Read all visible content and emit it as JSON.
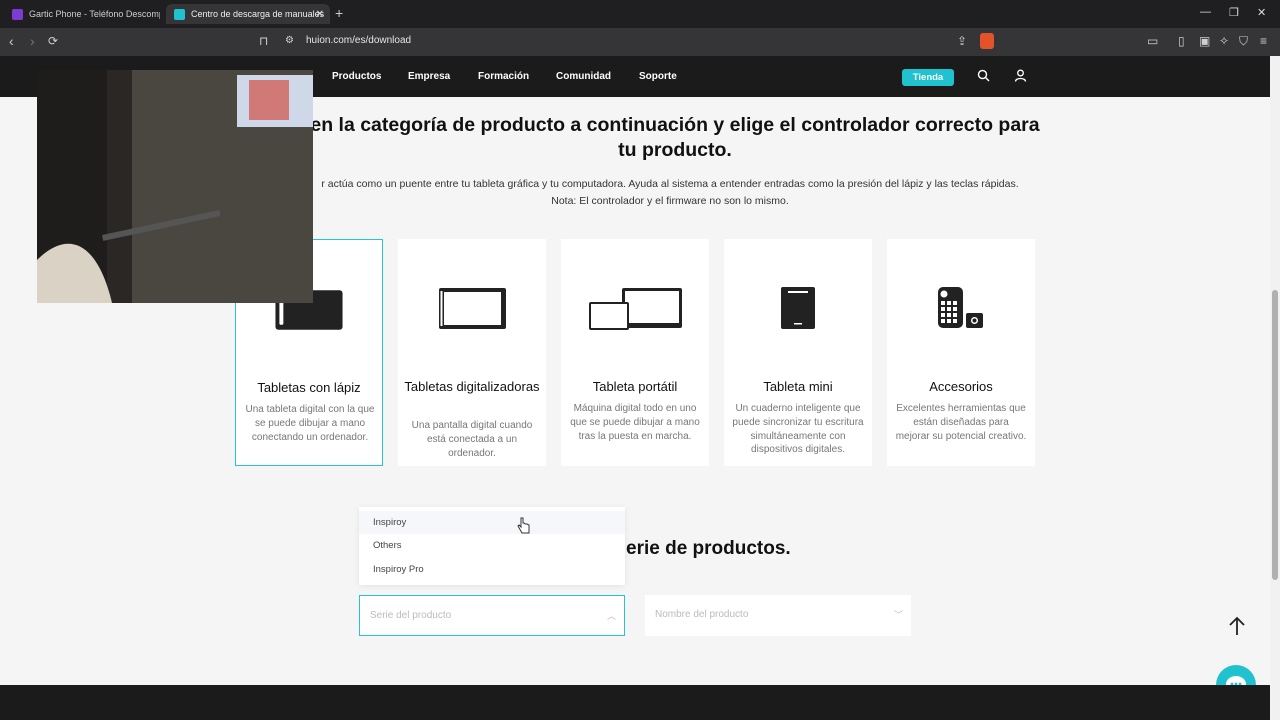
{
  "browser": {
    "tabs": [
      {
        "title": "Gartic Phone - Teléfono Descompuesto",
        "active": false
      },
      {
        "title": "Centro de descarga de manuales",
        "active": true
      }
    ],
    "url": "huion.com/es/download"
  },
  "header": {
    "nav": [
      "Productos",
      "Empresa",
      "Formación",
      "Comunidad",
      "Soporte"
    ],
    "shop_label": "Tienda"
  },
  "main": {
    "heading": "en la categoría de producto a continuación y elige el controlador correcto para tu producto.",
    "description_line1": "r actúa como un puente entre tu tableta gráfica y tu computadora. Ayuda al sistema a entender entradas como la presión del lápiz y las teclas rápidas.",
    "description_line2": "Nota: El controlador y el firmware no son lo mismo.",
    "categories": [
      {
        "title": "Tabletas con lápiz",
        "desc": "Una tableta digital con la que se puede dibujar a mano conectando un ordenador.",
        "selected": true
      },
      {
        "title": "Tabletas digitalizadoras",
        "desc": "Una pantalla digital cuando está conectada a un ordenador.",
        "selected": false
      },
      {
        "title": "Tableta portátil",
        "desc": "Máquina digital todo en uno que se puede dibujar a mano tras la puesta en marcha.",
        "selected": false
      },
      {
        "title": "Tableta mini",
        "desc": "Un cuaderno inteligente que puede sincronizar tu escritura simultáneamente con dispositivos digitales.",
        "selected": false
      },
      {
        "title": "Accesorios",
        "desc": "Excelentes herramientas que están diseñadas para mejorar su potencial creativo.",
        "selected": false
      }
    ],
    "series_title": "erie de productos.",
    "dropdown_options": [
      "Inspiroy",
      "Others",
      "Inspiroy Pro"
    ],
    "series_placeholder": "Serie del producto",
    "product_placeholder": "Nombre del producto"
  },
  "colors": {
    "accent": "#20c2cf",
    "header_bg": "#1b1b1b",
    "page_bg": "#f5f5f5"
  }
}
